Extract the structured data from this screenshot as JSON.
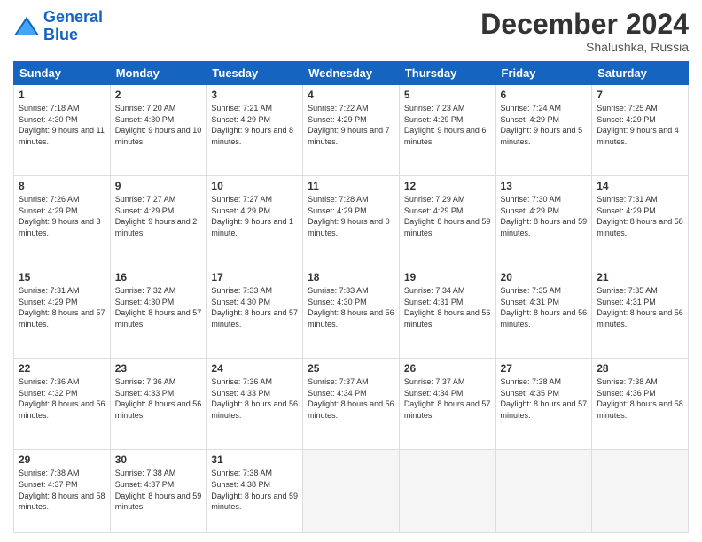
{
  "header": {
    "logo_line1": "General",
    "logo_line2": "Blue",
    "month_title": "December 2024",
    "location": "Shalushka, Russia"
  },
  "weekdays": [
    "Sunday",
    "Monday",
    "Tuesday",
    "Wednesday",
    "Thursday",
    "Friday",
    "Saturday"
  ],
  "weeks": [
    [
      {
        "day": "1",
        "rise": "7:18 AM",
        "set": "4:30 PM",
        "daylight": "9 hours and 11 minutes."
      },
      {
        "day": "2",
        "rise": "7:20 AM",
        "set": "4:30 PM",
        "daylight": "9 hours and 10 minutes."
      },
      {
        "day": "3",
        "rise": "7:21 AM",
        "set": "4:29 PM",
        "daylight": "9 hours and 8 minutes."
      },
      {
        "day": "4",
        "rise": "7:22 AM",
        "set": "4:29 PM",
        "daylight": "9 hours and 7 minutes."
      },
      {
        "day": "5",
        "rise": "7:23 AM",
        "set": "4:29 PM",
        "daylight": "9 hours and 6 minutes."
      },
      {
        "day": "6",
        "rise": "7:24 AM",
        "set": "4:29 PM",
        "daylight": "9 hours and 5 minutes."
      },
      {
        "day": "7",
        "rise": "7:25 AM",
        "set": "4:29 PM",
        "daylight": "9 hours and 4 minutes."
      }
    ],
    [
      {
        "day": "8",
        "rise": "7:26 AM",
        "set": "4:29 PM",
        "daylight": "9 hours and 3 minutes."
      },
      {
        "day": "9",
        "rise": "7:27 AM",
        "set": "4:29 PM",
        "daylight": "9 hours and 2 minutes."
      },
      {
        "day": "10",
        "rise": "7:27 AM",
        "set": "4:29 PM",
        "daylight": "9 hours and 1 minute."
      },
      {
        "day": "11",
        "rise": "7:28 AM",
        "set": "4:29 PM",
        "daylight": "9 hours and 0 minutes."
      },
      {
        "day": "12",
        "rise": "7:29 AM",
        "set": "4:29 PM",
        "daylight": "8 hours and 59 minutes."
      },
      {
        "day": "13",
        "rise": "7:30 AM",
        "set": "4:29 PM",
        "daylight": "8 hours and 59 minutes."
      },
      {
        "day": "14",
        "rise": "7:31 AM",
        "set": "4:29 PM",
        "daylight": "8 hours and 58 minutes."
      }
    ],
    [
      {
        "day": "15",
        "rise": "7:31 AM",
        "set": "4:29 PM",
        "daylight": "8 hours and 57 minutes."
      },
      {
        "day": "16",
        "rise": "7:32 AM",
        "set": "4:30 PM",
        "daylight": "8 hours and 57 minutes."
      },
      {
        "day": "17",
        "rise": "7:33 AM",
        "set": "4:30 PM",
        "daylight": "8 hours and 57 minutes."
      },
      {
        "day": "18",
        "rise": "7:33 AM",
        "set": "4:30 PM",
        "daylight": "8 hours and 56 minutes."
      },
      {
        "day": "19",
        "rise": "7:34 AM",
        "set": "4:31 PM",
        "daylight": "8 hours and 56 minutes."
      },
      {
        "day": "20",
        "rise": "7:35 AM",
        "set": "4:31 PM",
        "daylight": "8 hours and 56 minutes."
      },
      {
        "day": "21",
        "rise": "7:35 AM",
        "set": "4:31 PM",
        "daylight": "8 hours and 56 minutes."
      }
    ],
    [
      {
        "day": "22",
        "rise": "7:36 AM",
        "set": "4:32 PM",
        "daylight": "8 hours and 56 minutes."
      },
      {
        "day": "23",
        "rise": "7:36 AM",
        "set": "4:33 PM",
        "daylight": "8 hours and 56 minutes."
      },
      {
        "day": "24",
        "rise": "7:36 AM",
        "set": "4:33 PM",
        "daylight": "8 hours and 56 minutes."
      },
      {
        "day": "25",
        "rise": "7:37 AM",
        "set": "4:34 PM",
        "daylight": "8 hours and 56 minutes."
      },
      {
        "day": "26",
        "rise": "7:37 AM",
        "set": "4:34 PM",
        "daylight": "8 hours and 57 minutes."
      },
      {
        "day": "27",
        "rise": "7:38 AM",
        "set": "4:35 PM",
        "daylight": "8 hours and 57 minutes."
      },
      {
        "day": "28",
        "rise": "7:38 AM",
        "set": "4:36 PM",
        "daylight": "8 hours and 58 minutes."
      }
    ],
    [
      {
        "day": "29",
        "rise": "7:38 AM",
        "set": "4:37 PM",
        "daylight": "8 hours and 58 minutes."
      },
      {
        "day": "30",
        "rise": "7:38 AM",
        "set": "4:37 PM",
        "daylight": "8 hours and 59 minutes."
      },
      {
        "day": "31",
        "rise": "7:38 AM",
        "set": "4:38 PM",
        "daylight": "8 hours and 59 minutes."
      },
      null,
      null,
      null,
      null
    ]
  ]
}
